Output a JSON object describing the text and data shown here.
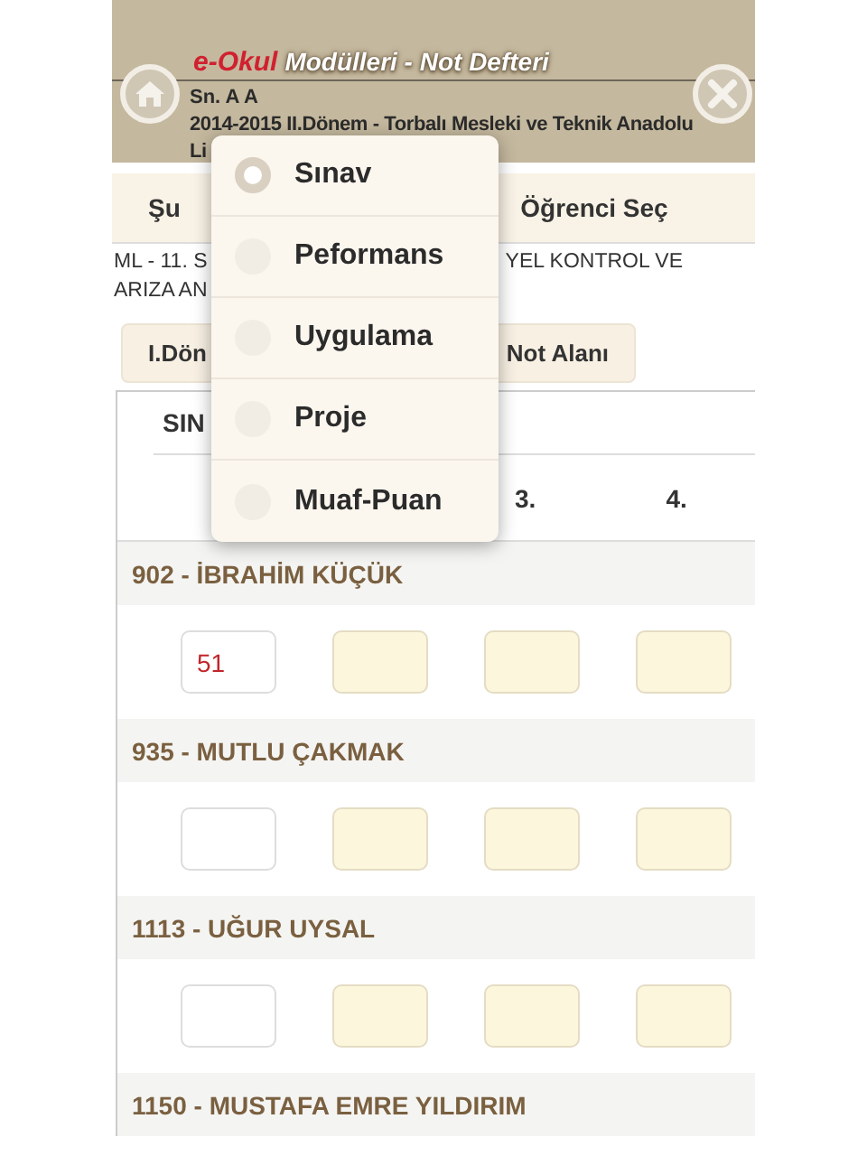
{
  "header": {
    "brand": "e-Okul",
    "title": "Modülleri - Not Defteri",
    "user": "Sn. A A",
    "term": "2014-2015 II.Dönem - Torbalı Mesleki ve Teknik Anadolu",
    "term_cont": "Li"
  },
  "nav_buttons": [
    {
      "label": "Şu"
    },
    {
      "label": "Öğrenci Seç"
    }
  ],
  "course": {
    "line1_left": "ML - 11. S",
    "line1_right": "YEL KONTROL VE",
    "line2_left": "ARIZA AN"
  },
  "period_tabs": [
    {
      "label": "I.Dön"
    },
    {
      "label": "Not Alanı"
    }
  ],
  "table": {
    "heading": "SIN",
    "columns": [
      "3.",
      "4."
    ]
  },
  "students": [
    {
      "name": "902 - İBRAHİM KÜÇÜK",
      "grades": [
        {
          "value": "51",
          "enabled": true
        },
        {
          "enabled": false
        },
        {
          "enabled": false
        },
        {
          "enabled": false
        }
      ]
    },
    {
      "name": "935 - MUTLU ÇAKMAK",
      "grades": [
        {
          "enabled": true
        },
        {
          "enabled": false
        },
        {
          "enabled": false
        },
        {
          "enabled": false
        }
      ]
    },
    {
      "name": "1113 - UĞUR UYSAL",
      "grades": [
        {
          "enabled": true
        },
        {
          "enabled": false
        },
        {
          "enabled": false
        },
        {
          "enabled": false
        }
      ]
    },
    {
      "name": "1150 - MUSTAFA EMRE YILDIRIM"
    }
  ],
  "menu": {
    "items": [
      {
        "label": "Sınav",
        "selected": true
      },
      {
        "label": "Peformans",
        "selected": false
      },
      {
        "label": "Uygulama",
        "selected": false
      },
      {
        "label": "Proje",
        "selected": false
      },
      {
        "label": "Muaf-Puan",
        "selected": false
      }
    ]
  }
}
